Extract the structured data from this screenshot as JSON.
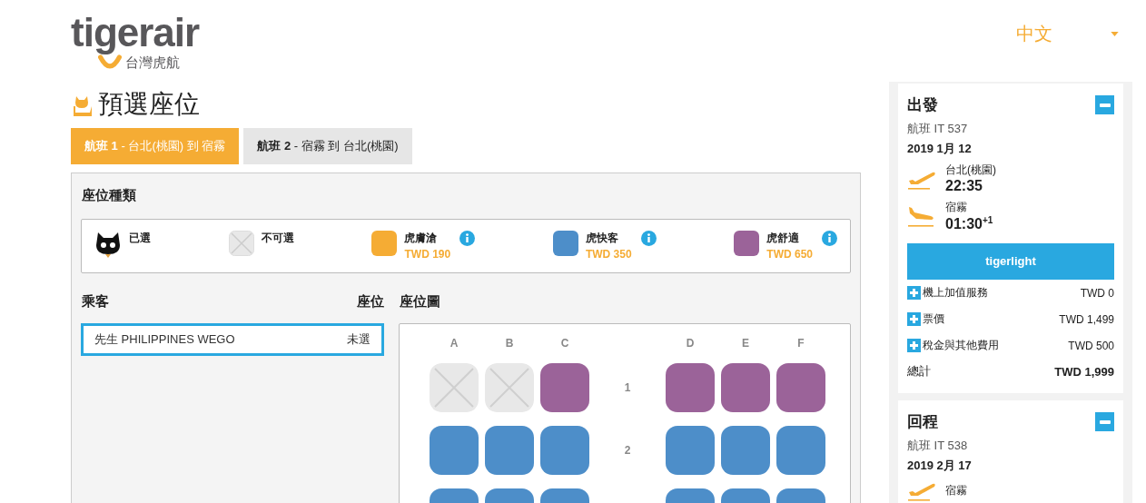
{
  "header": {
    "logo": {
      "wordmark": "tigerair",
      "subtitle": "台灣虎航"
    },
    "language": "中文"
  },
  "page_title": "預選座位",
  "flight_tabs": [
    {
      "label": "航班 1",
      "route": " - 台北(桃園) 到 宿霧",
      "selected": true
    },
    {
      "label": "航班 2",
      "route": " - 宿霧 到 台北(桃園)",
      "selected": false
    }
  ],
  "seat_types": {
    "title": "座位種類",
    "legend": [
      {
        "kind": "selected",
        "name": "已選"
      },
      {
        "kind": "unavailable",
        "name": "不可選"
      },
      {
        "kind": "seat",
        "name": "虎膚滄",
        "price": "TWD 190",
        "color": "#f5ac34"
      },
      {
        "kind": "seat",
        "name": "虎快客",
        "price": "TWD 350",
        "color": "#4d8ec9"
      },
      {
        "kind": "seat",
        "name": "虎舒適",
        "price": "TWD 650",
        "color": "#9b6399"
      }
    ]
  },
  "passengers": {
    "title": "乘客",
    "seat_heading": "座位",
    "rows": [
      {
        "name": "先生 PHILIPPINES WEGO",
        "seat": "未選",
        "selected": true
      }
    ]
  },
  "seat_map": {
    "title": "座位圖",
    "columns": [
      "A",
      "B",
      "C",
      "D",
      "E",
      "F"
    ],
    "rows": [
      {
        "number": "1",
        "seats": [
          {
            "kind": "unavailable"
          },
          {
            "kind": "unavailable"
          },
          {
            "kind": "seat",
            "color": "#9b6399"
          },
          {
            "kind": "seat",
            "color": "#9b6399"
          },
          {
            "kind": "seat",
            "color": "#9b6399"
          },
          {
            "kind": "seat",
            "color": "#9b6399"
          }
        ]
      },
      {
        "number": "2",
        "seats": [
          {
            "kind": "seat",
            "color": "#4d8ec9"
          },
          {
            "kind": "seat",
            "color": "#4d8ec9"
          },
          {
            "kind": "seat",
            "color": "#4d8ec9"
          },
          {
            "kind": "seat",
            "color": "#4d8ec9"
          },
          {
            "kind": "seat",
            "color": "#4d8ec9"
          },
          {
            "kind": "seat",
            "color": "#4d8ec9"
          }
        ]
      },
      {
        "seats": [
          {
            "kind": "seat",
            "color": "#4d8ec9"
          },
          {
            "kind": "seat",
            "color": "#4d8ec9"
          },
          {
            "kind": "seat",
            "color": "#4d8ec9"
          },
          {
            "kind": "seat",
            "color": "#4d8ec9"
          },
          {
            "kind": "seat",
            "color": "#4d8ec9"
          },
          {
            "kind": "seat",
            "color": "#4d8ec9"
          }
        ]
      }
    ]
  },
  "summary": [
    {
      "title": "出發",
      "flight": "航班 IT 537",
      "date": "2019 1月 12",
      "expanded": true,
      "legs": [
        {
          "kind": "takeoff",
          "place": "台北(桃園)",
          "time": "22:35"
        },
        {
          "kind": "landing",
          "place": "宿霧",
          "time": "01:30",
          "day_offset": "+1"
        }
      ],
      "fare": "tigerlight",
      "charges": [
        {
          "label": "機上加值服務",
          "amount": "TWD 0"
        },
        {
          "label": "票價",
          "amount": "TWD 1,499"
        },
        {
          "label": "稅金與其他費用",
          "amount": "TWD 500"
        }
      ],
      "total_label": "總計",
      "total": "TWD 1,999"
    },
    {
      "title": "回程",
      "flight": "航班 IT 538",
      "date": "2019 2月 17",
      "expanded": true,
      "legs": [
        {
          "kind": "takeoff",
          "place": "宿霧"
        }
      ]
    }
  ]
}
